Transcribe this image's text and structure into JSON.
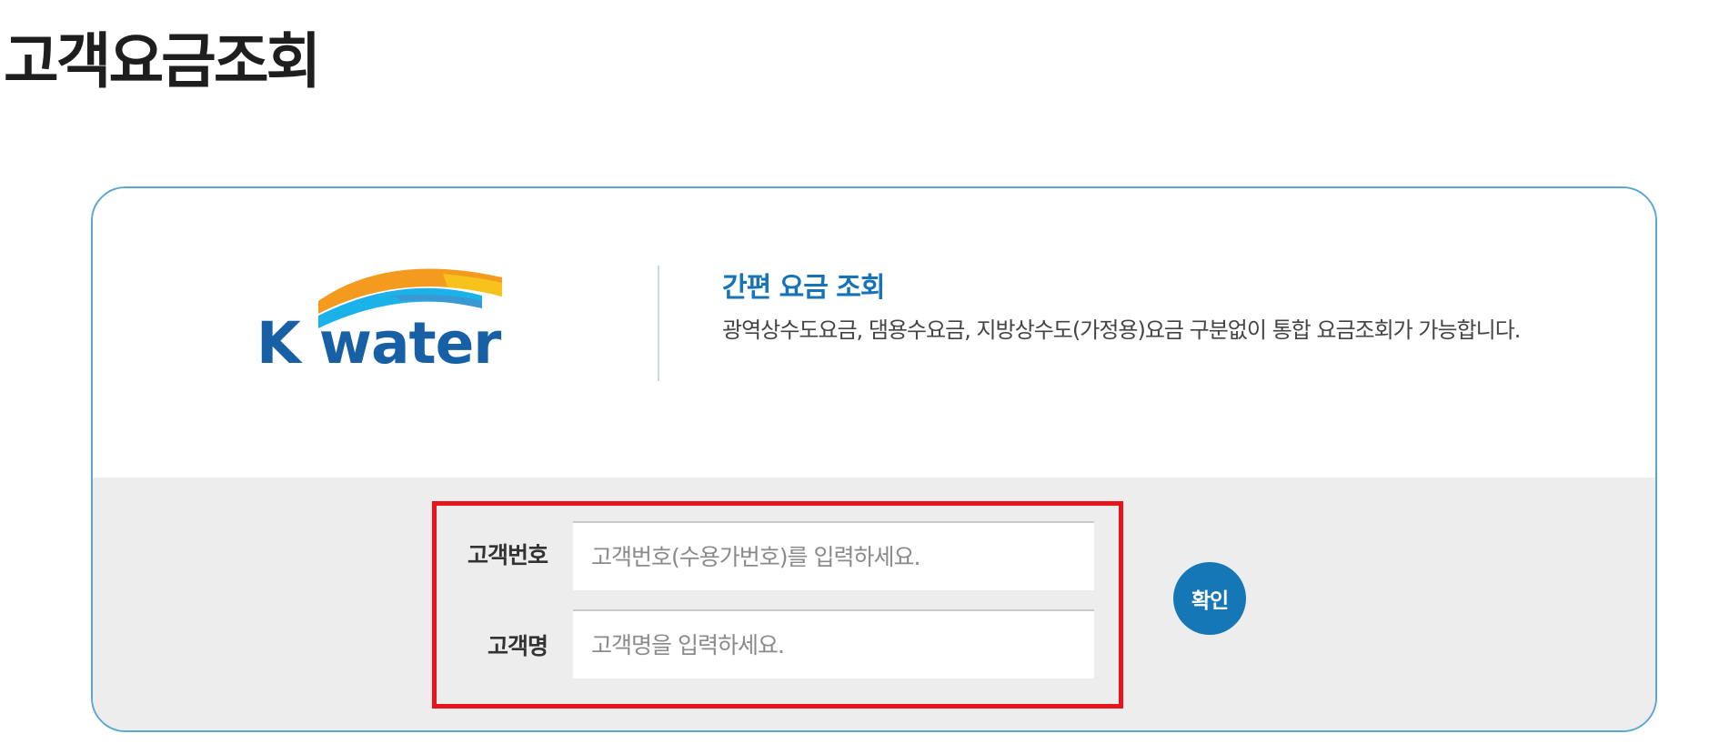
{
  "page": {
    "title": "고객요금조회"
  },
  "logo": {
    "text": "K water",
    "colors": {
      "orange": "#f39a1f",
      "yellow": "#f7c21b",
      "light_blue": "#1ab2e8",
      "mid_blue": "#3a98d3",
      "text_blue": "#1760a5"
    }
  },
  "info": {
    "title": "간편 요금 조회",
    "description": "광역상수도요금, 댐용수요금, 지방상수도(가정용)요금 구분없이 통합 요금조회가 가능합니다."
  },
  "form": {
    "customer_number": {
      "label": "고객번호",
      "placeholder": "고객번호(수용가번호)를 입력하세요.",
      "value": ""
    },
    "customer_name": {
      "label": "고객명",
      "placeholder": "고객명을 입력하세요.",
      "value": ""
    },
    "confirm_label": "확인"
  },
  "colors": {
    "card_border": "#5aa8d2",
    "form_background": "#ededed",
    "highlight_border": "#e8141a",
    "button": "#1577b5",
    "info_title": "#1773b8"
  }
}
